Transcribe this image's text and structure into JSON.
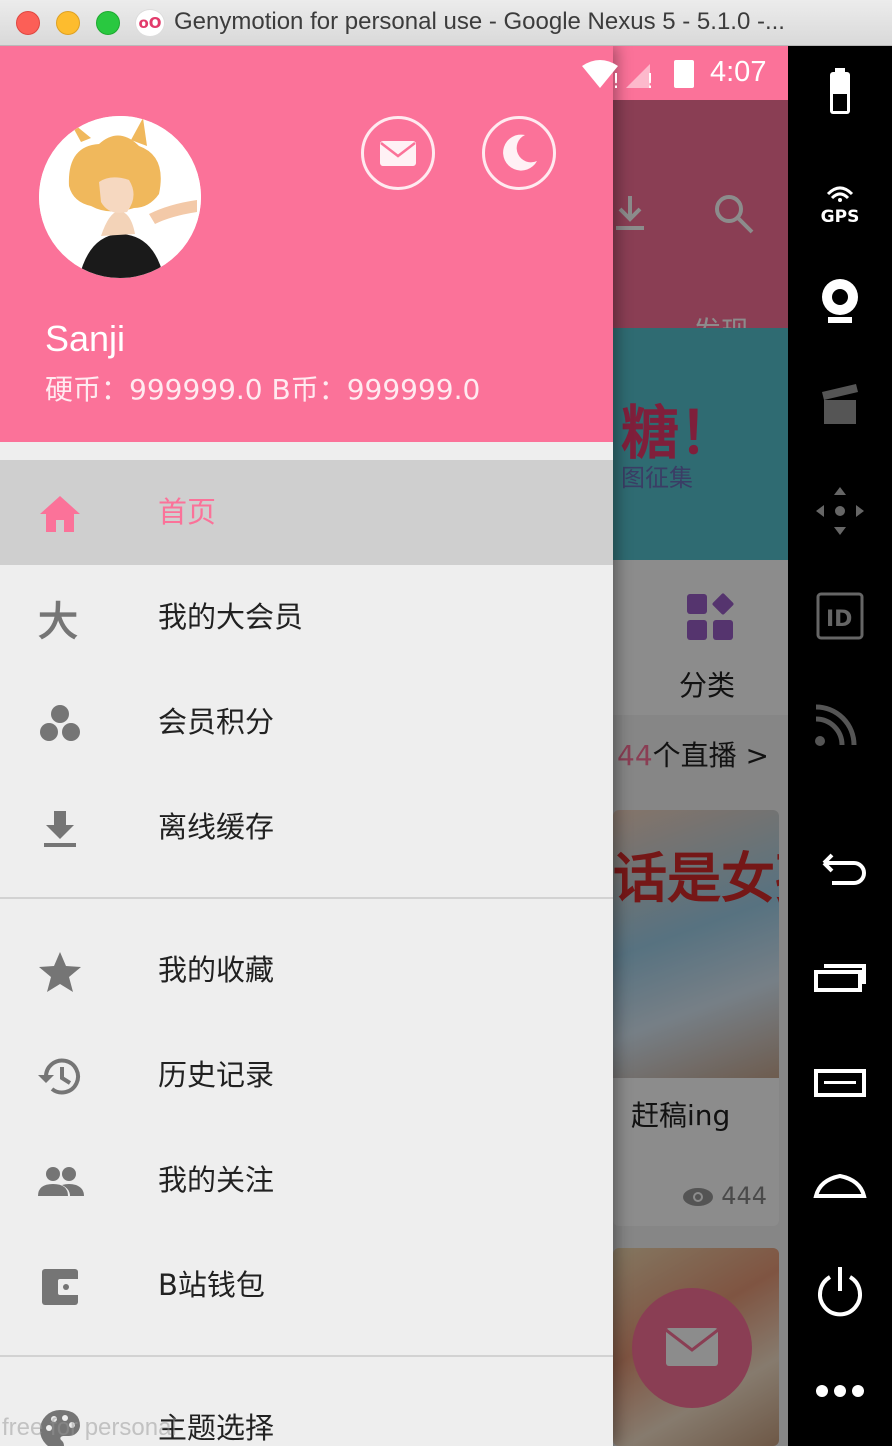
{
  "window": {
    "title": "Genymotion for personal use - Google Nexus 5 - 5.1.0 -...",
    "app_icon_text": "oO"
  },
  "status_bar": {
    "time": "4:07"
  },
  "background_app": {
    "tab_visible": "发现",
    "banner_text": "糖！",
    "banner_sub": "图征集",
    "category_label": "分类",
    "live_count": "44",
    "live_suffix": "个直播 >",
    "card_title_img": "话是女孩",
    "card_name": "赶稿ing",
    "card_views": "444"
  },
  "drawer": {
    "user": {
      "name": "Sanji",
      "coins": "硬币：999999.0  B币：999999.0"
    },
    "menu": [
      {
        "label": "首页",
        "icon": "home-icon",
        "active": true
      },
      {
        "label": "我的大会员",
        "icon": "vip-icon",
        "active": false
      },
      {
        "label": "会员积分",
        "icon": "points-icon",
        "active": false
      },
      {
        "label": "离线缓存",
        "icon": "download-icon",
        "active": false
      },
      {
        "label": "我的收藏",
        "icon": "star-icon",
        "active": false
      },
      {
        "label": "历史记录",
        "icon": "history-icon",
        "active": false
      },
      {
        "label": "我的关注",
        "icon": "people-icon",
        "active": false
      },
      {
        "label": "B站钱包",
        "icon": "wallet-icon",
        "active": false
      },
      {
        "label": "主题选择",
        "icon": "palette-icon",
        "active": false
      }
    ]
  },
  "watermark": "free for personal",
  "sidebar": {
    "gps_label": "GPS",
    "buttons": [
      "battery-icon",
      "gps-icon",
      "webcam-icon",
      "capture-icon",
      "dpad-icon",
      "id-icon",
      "cast-icon",
      "back-icon",
      "recent-apps-icon",
      "menu-icon",
      "home-nav-icon",
      "power-icon",
      "more-icon"
    ]
  },
  "colors": {
    "accent": "#fb7299",
    "drawer_bg": "#eeeeee",
    "active_row": "#cfcfcf"
  }
}
